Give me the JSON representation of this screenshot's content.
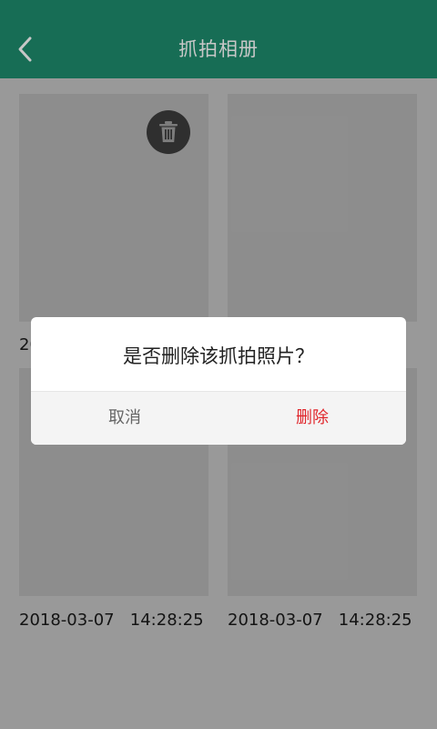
{
  "header": {
    "title": "抓拍相册"
  },
  "photos": [
    {
      "date": "",
      "time": ""
    },
    {
      "date": "",
      "time": ""
    },
    {
      "date": "2018-03-07",
      "time": "14:28:25"
    },
    {
      "date": "2018-03-07",
      "time": "14:28:25"
    }
  ],
  "partial_caption": "20",
  "dialog": {
    "message": "是否删除该抓拍照片？",
    "cancel_label": "取消",
    "delete_label": "删除"
  },
  "colors": {
    "accent": "#1e8c6e",
    "danger": "#e0262b"
  },
  "icons": {
    "back": "chevron-left-icon",
    "delete": "trash-icon"
  }
}
